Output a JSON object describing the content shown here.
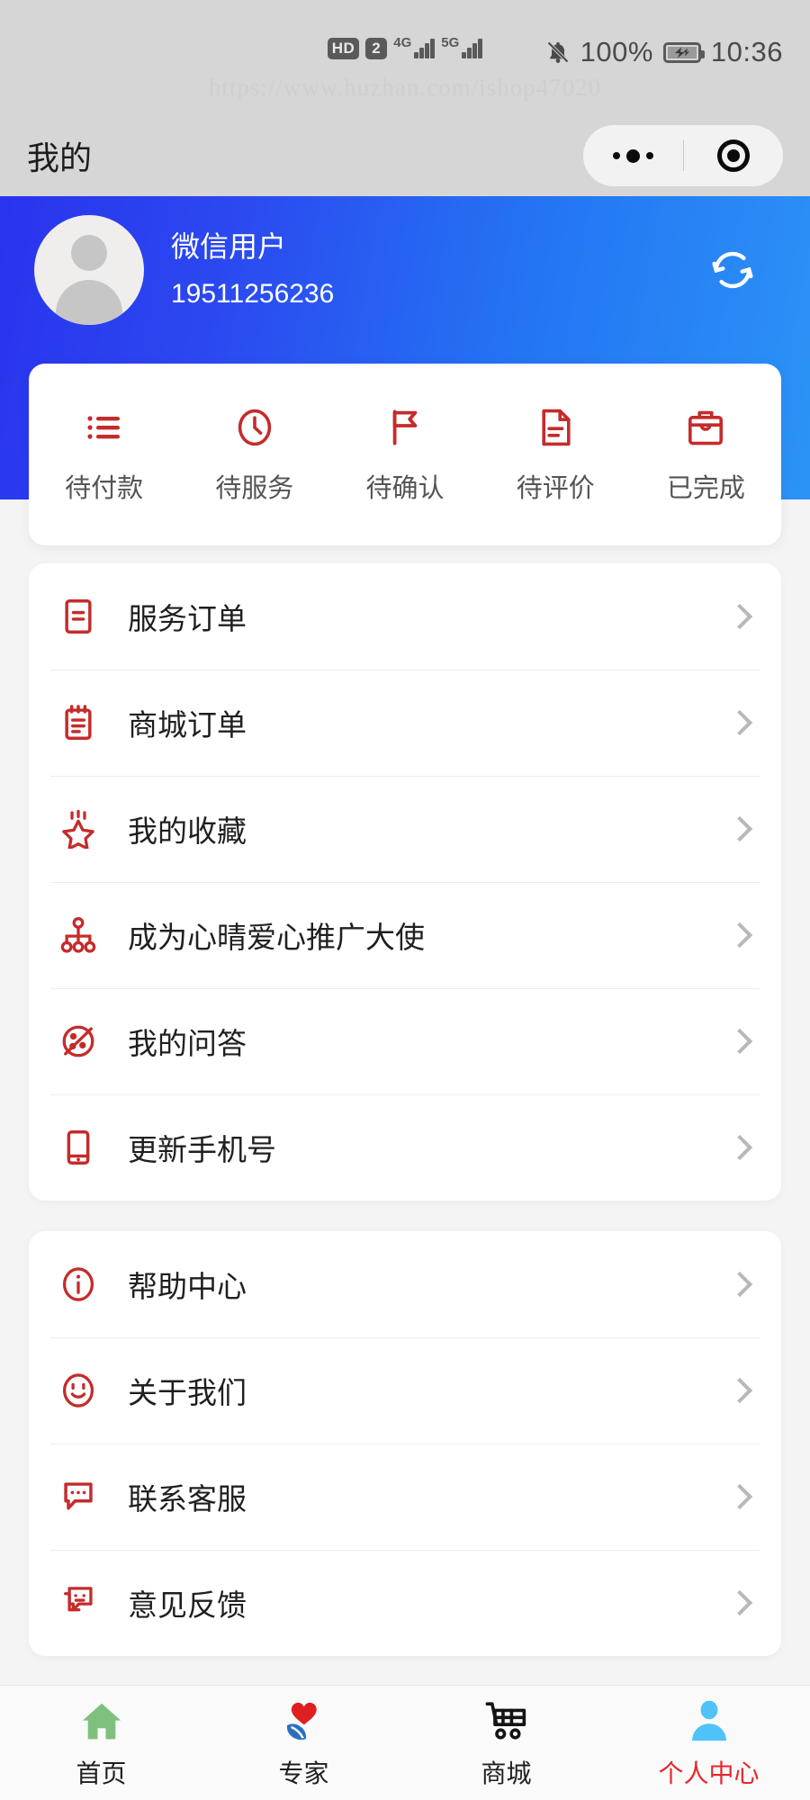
{
  "status_bar": {
    "hd_badge": "HD",
    "sim_badge": "2",
    "net_label_1": "4G",
    "net_label_2": "5G",
    "battery_percent": "100%",
    "time": "10:36",
    "bell_icon": "bell-muted-icon",
    "battery_icon": "battery-charging-icon"
  },
  "watermark": "https://www.huzhan.com/ishop47020",
  "navbar": {
    "title": "我的",
    "capsule": {
      "menu_icon": "more-dots-icon",
      "target_icon": "target-circle-icon"
    }
  },
  "profile": {
    "name": "微信用户",
    "phone": "19511256236",
    "avatar_icon": "user-avatar-icon",
    "refresh_icon": "refresh-sync-icon"
  },
  "order_tabs": [
    {
      "label": "待付款",
      "icon": "list-lines-icon"
    },
    {
      "label": "待服务",
      "icon": "clock-icon"
    },
    {
      "label": "待确认",
      "icon": "flag-icon"
    },
    {
      "label": "待评价",
      "icon": "document-lines-icon"
    },
    {
      "label": "已完成",
      "icon": "briefcase-icon"
    }
  ],
  "menu_group_1": [
    {
      "label": "服务订单",
      "icon": "service-order-icon"
    },
    {
      "label": "商城订单",
      "icon": "mall-order-clipboard-icon"
    },
    {
      "label": "我的收藏",
      "icon": "star-favorite-icon"
    },
    {
      "label": "成为心晴爱心推广大使",
      "icon": "network-share-icon"
    },
    {
      "label": "我的问答",
      "icon": "qa-planet-icon"
    },
    {
      "label": "更新手机号",
      "icon": "mobile-phone-icon"
    }
  ],
  "menu_group_2": [
    {
      "label": "帮助中心",
      "icon": "info-circle-icon"
    },
    {
      "label": "关于我们",
      "icon": "smiley-face-icon"
    },
    {
      "label": "联系客服",
      "icon": "chat-bubble-dots-icon"
    },
    {
      "label": "意见反馈",
      "icon": "feedback-bubble-icon"
    }
  ],
  "tabbar": [
    {
      "label": "首页",
      "icon": "home-icon",
      "active": false
    },
    {
      "label": "专家",
      "icon": "heart-hand-expert-icon",
      "active": false
    },
    {
      "label": "商城",
      "icon": "shopping-cart-icon",
      "active": false
    },
    {
      "label": "个人中心",
      "icon": "person-profile-icon",
      "active": true
    }
  ],
  "colors": {
    "accent_red": "#c52b2b",
    "hero_blue_start": "#2a33ee",
    "hero_blue_end": "#2b93f6",
    "active_tab_red": "#e8262a",
    "statusbar_gray": "#d6d6d6"
  }
}
